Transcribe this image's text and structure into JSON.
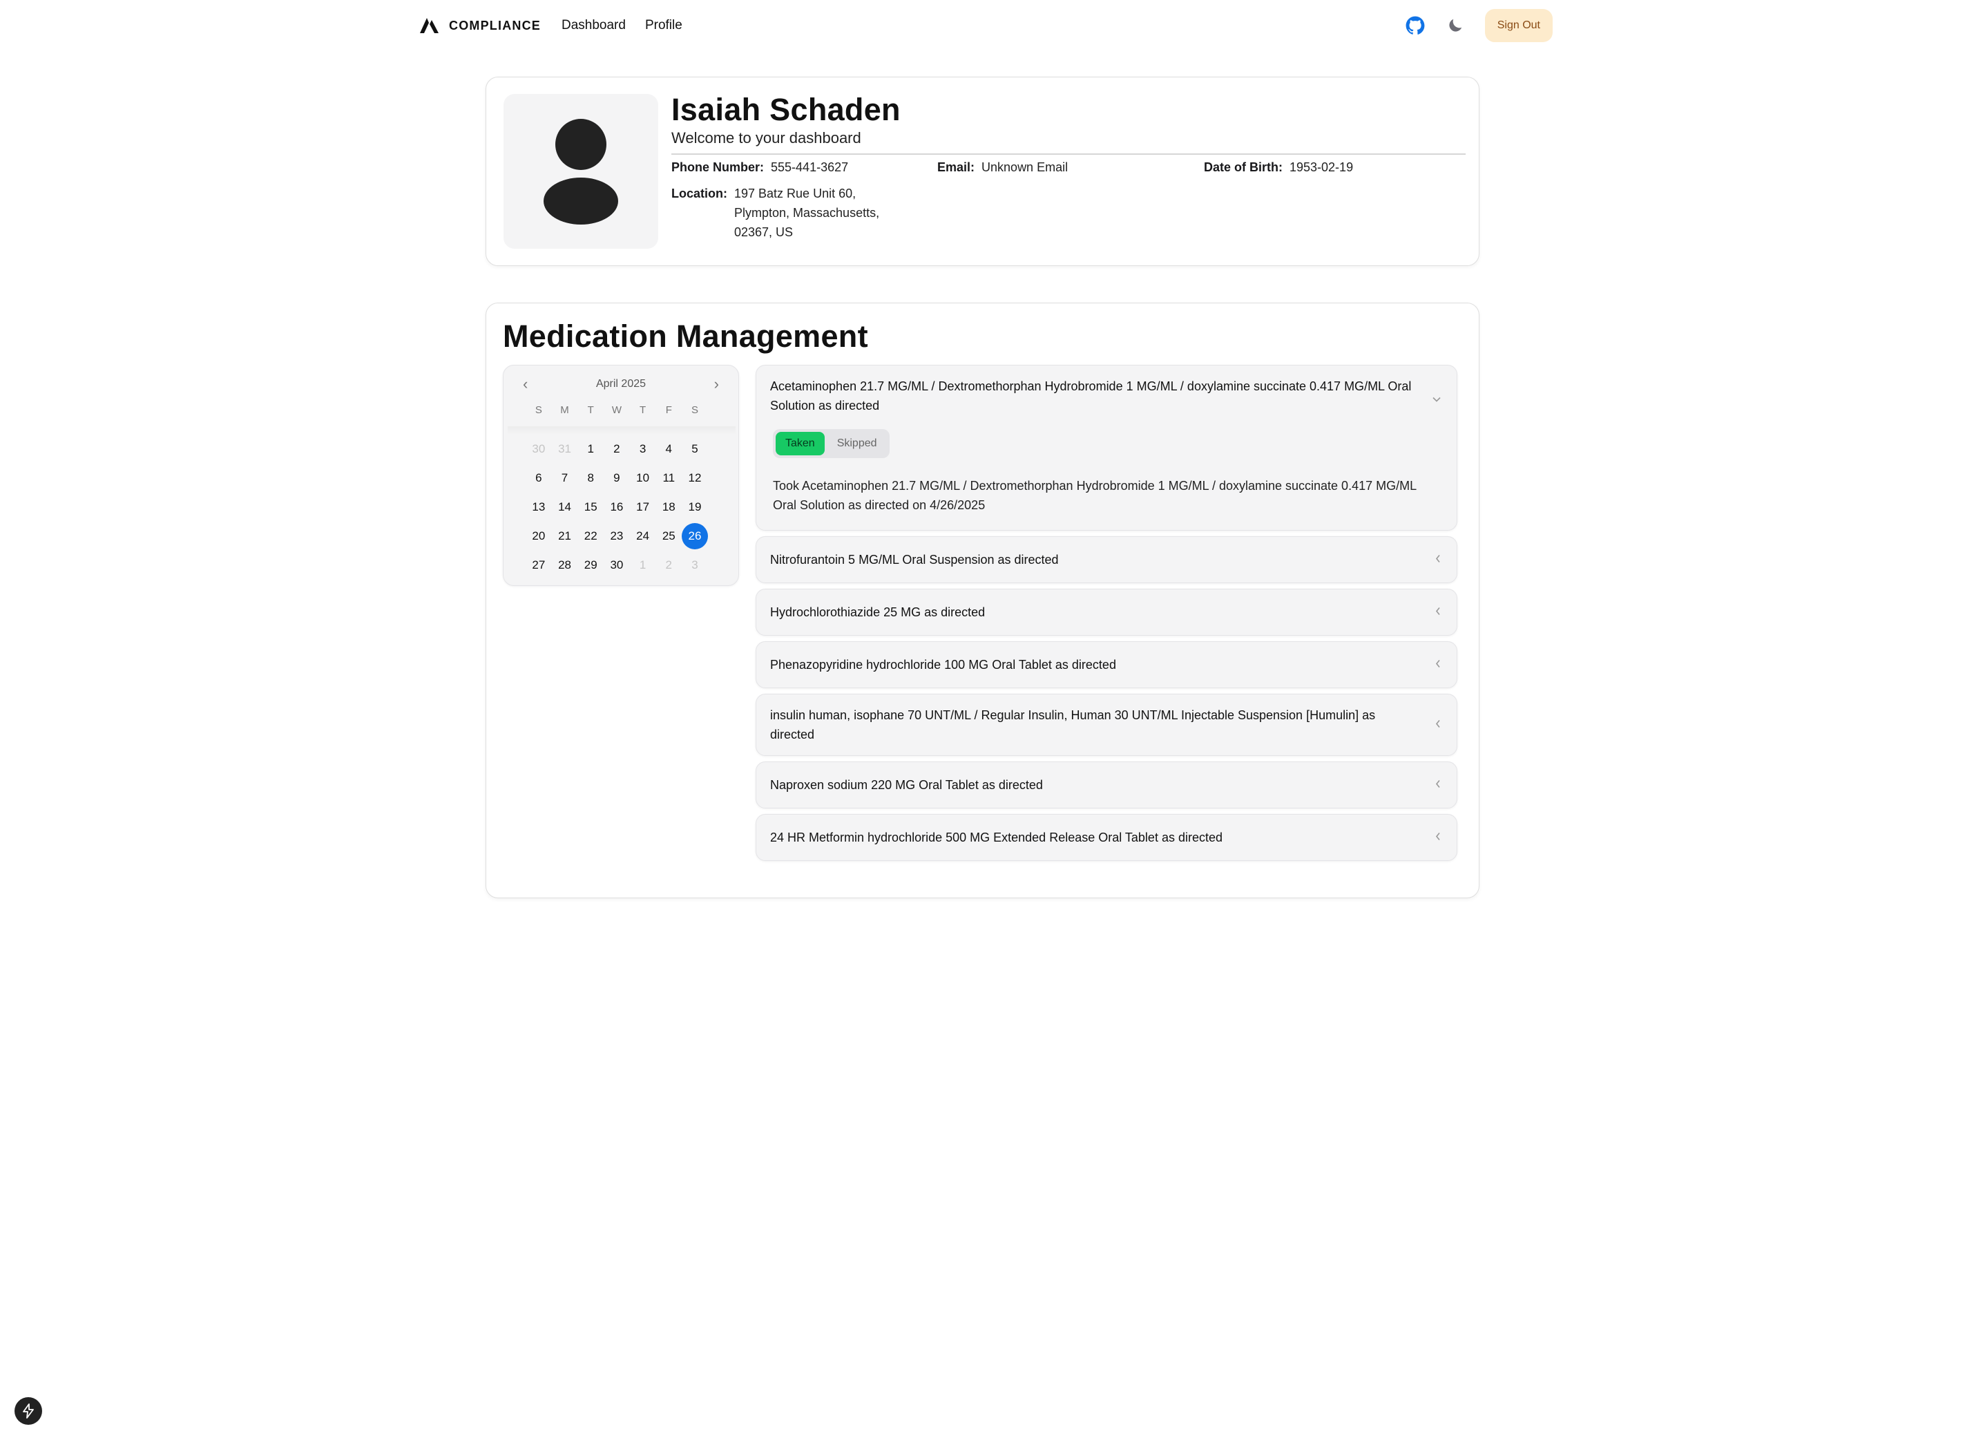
{
  "nav": {
    "brand": "COMPLIANCE",
    "links": [
      "Dashboard",
      "Profile"
    ],
    "github_icon": "github-icon",
    "theme_icon": "moon-icon",
    "sign_out": "Sign Out"
  },
  "profile": {
    "name": "Isaiah Schaden",
    "welcome": "Welcome to your dashboard",
    "phone_label": "Phone Number:",
    "phone": "555-441-3627",
    "email_label": "Email:",
    "email": "Unknown Email",
    "dob_label": "Date of Birth:",
    "dob": "1953-02-19",
    "location_label": "Location:",
    "location": "197 Batz Rue Unit 60, Plympton, Massachusetts, 02367, US"
  },
  "medication": {
    "title": "Medication Management",
    "calendar": {
      "month": "April 2025",
      "weekdays": [
        "S",
        "M",
        "T",
        "W",
        "T",
        "F",
        "S"
      ],
      "days": [
        {
          "d": "30",
          "muted": true
        },
        {
          "d": "31",
          "muted": true
        },
        {
          "d": "1"
        },
        {
          "d": "2"
        },
        {
          "d": "3"
        },
        {
          "d": "4"
        },
        {
          "d": "5"
        },
        {
          "d": "6"
        },
        {
          "d": "7"
        },
        {
          "d": "8"
        },
        {
          "d": "9"
        },
        {
          "d": "10"
        },
        {
          "d": "11"
        },
        {
          "d": "12"
        },
        {
          "d": "13"
        },
        {
          "d": "14"
        },
        {
          "d": "15"
        },
        {
          "d": "16"
        },
        {
          "d": "17"
        },
        {
          "d": "18"
        },
        {
          "d": "19"
        },
        {
          "d": "20"
        },
        {
          "d": "21"
        },
        {
          "d": "22"
        },
        {
          "d": "23"
        },
        {
          "d": "24"
        },
        {
          "d": "25"
        },
        {
          "d": "26",
          "selected": true
        },
        {
          "d": "27"
        },
        {
          "d": "28"
        },
        {
          "d": "29"
        },
        {
          "d": "30"
        },
        {
          "d": "1",
          "muted": true
        },
        {
          "d": "2",
          "muted": true
        },
        {
          "d": "3",
          "muted": true
        }
      ],
      "selected_color": "#1173e6"
    },
    "items": [
      {
        "label": "Acetaminophen 21.7 MG/ML / Dextromethorphan Hydrobromide 1 MG/ML / doxylamine succinate 0.417 MG/ML Oral Solution as directed",
        "open": true,
        "status_options": [
          "Taken",
          "Skipped"
        ],
        "status_selected": "Taken",
        "note": "Took Acetaminophen 21.7 MG/ML / Dextromethorphan Hydrobromide 1 MG/ML / doxylamine succinate 0.417 MG/ML Oral Solution as directed on 4/26/2025"
      },
      {
        "label": "Nitrofurantoin 5 MG/ML Oral Suspension as directed"
      },
      {
        "label": "Hydrochlorothiazide 25 MG as directed"
      },
      {
        "label": "Phenazopyridine hydrochloride 100 MG Oral Tablet as directed"
      },
      {
        "label": "insulin human, isophane 70 UNT/ML / Regular Insulin, Human 30 UNT/ML Injectable Suspension [Humulin] as directed"
      },
      {
        "label": "Naproxen sodium 220 MG Oral Tablet as directed"
      },
      {
        "label": "24 HR Metformin hydrochloride 500 MG Extended Release Oral Tablet as directed"
      }
    ],
    "taken_color": "#17c964"
  },
  "fab_icon": "bolt-icon"
}
